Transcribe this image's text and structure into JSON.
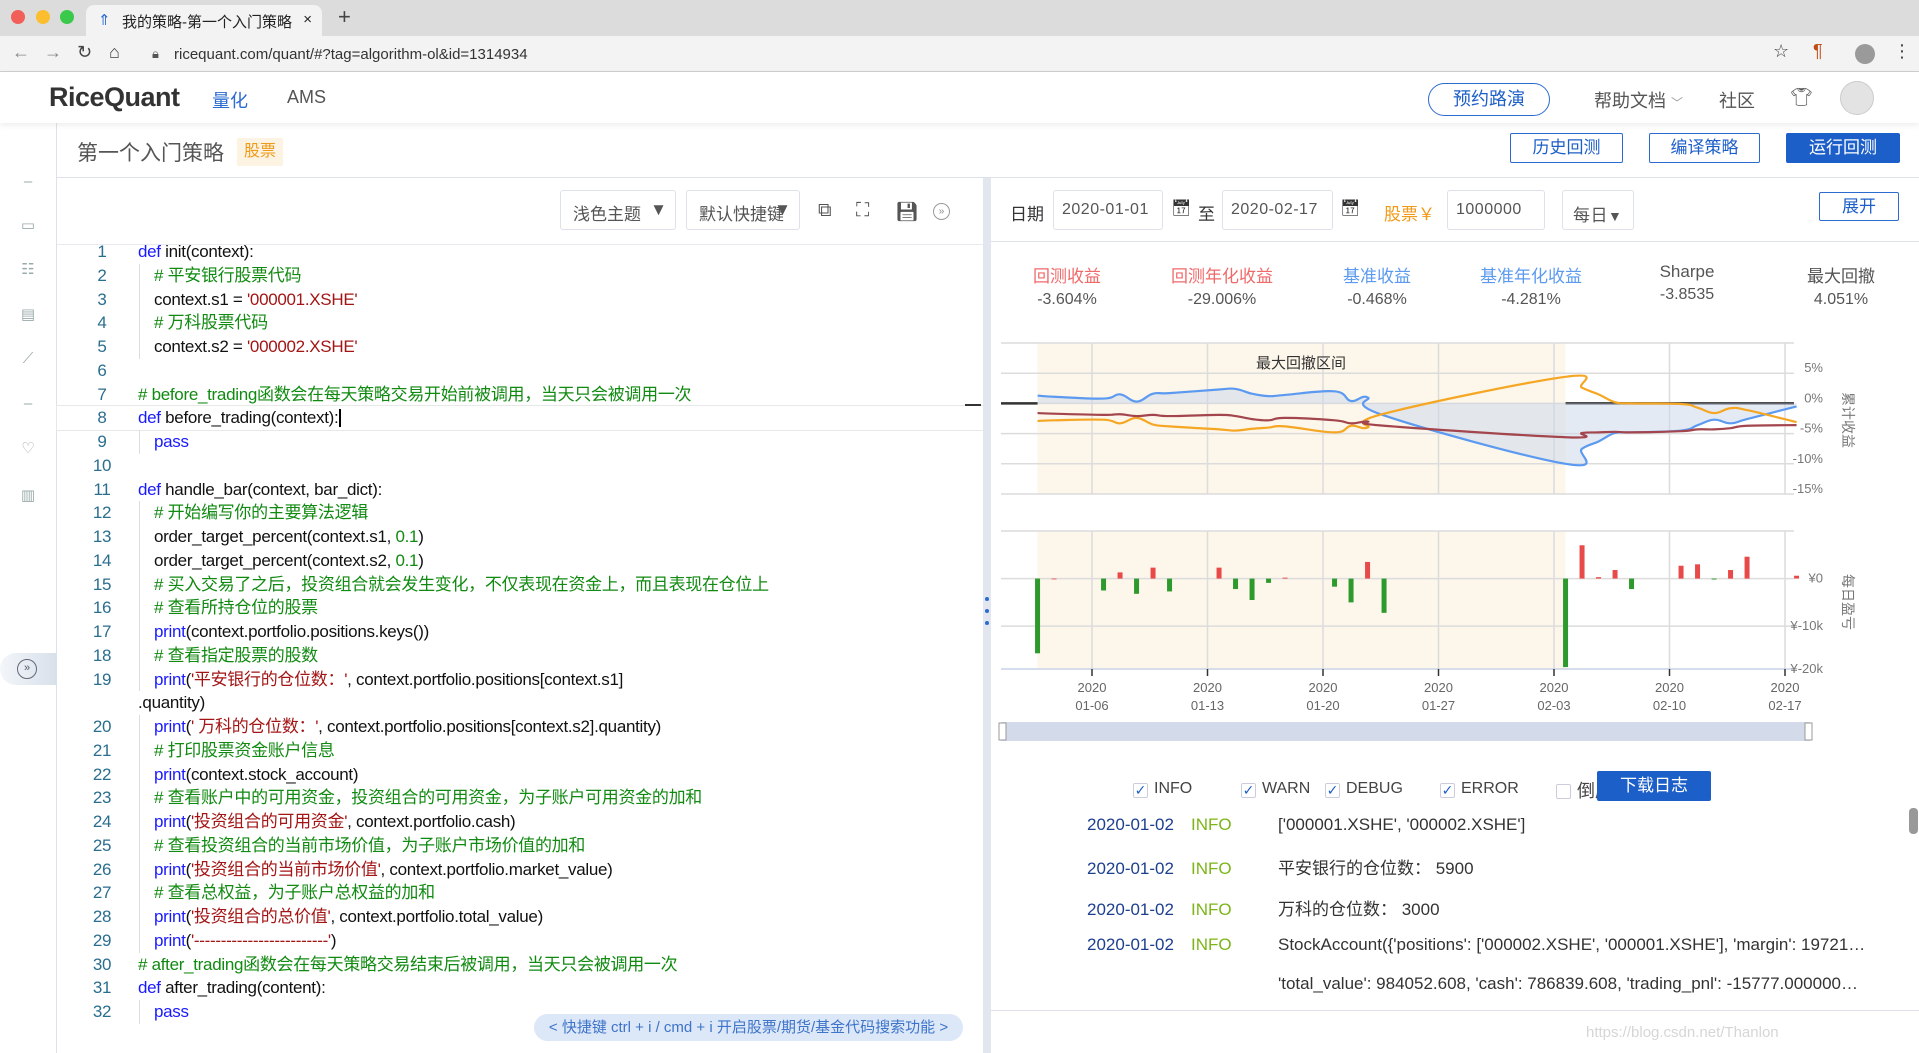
{
  "browser": {
    "tab_title": "我的策略-第一个入门策略",
    "tab_close": "×",
    "new_tab": "+",
    "url": "ricequant.com/quant/#?tag=algorithm-ol&id=1314934"
  },
  "nav": {
    "logo": "RiceQuant",
    "items": [
      {
        "label": "量化",
        "active": true
      },
      {
        "label": "AMS",
        "active": false
      }
    ],
    "roadshow": "预约路演",
    "help": "帮助文档",
    "community": "社区"
  },
  "strategy": {
    "title": "第一个入门策略",
    "badge": "股票",
    "history_button": "历史回测",
    "compile_button": "编译策略",
    "run_button": "运行回测"
  },
  "editor": {
    "theme": "浅色主题",
    "keymap": "默认快捷键",
    "hint": "< 快捷键 ctrl + i / cmd + i 开启股票/期货/基金代码搜索功能 >",
    "current_line": 8,
    "lines": [
      {
        "n": "1",
        "indent": 0,
        "tokens": [
          [
            "kw",
            "def"
          ],
          [
            "plain",
            " init(context):"
          ]
        ]
      },
      {
        "n": "2",
        "indent": 1,
        "tokens": [
          [
            "comment",
            "# 平安银行股票代码"
          ]
        ]
      },
      {
        "n": "3",
        "indent": 1,
        "tokens": [
          [
            "plain",
            "context.s1 = "
          ],
          [
            "str",
            "'000001.XSHE'"
          ]
        ]
      },
      {
        "n": "4",
        "indent": 1,
        "tokens": [
          [
            "comment",
            "# 万科股票代码"
          ]
        ]
      },
      {
        "n": "5",
        "indent": 1,
        "tokens": [
          [
            "plain",
            "context.s2 = "
          ],
          [
            "str",
            "'000002.XSHE'"
          ]
        ]
      },
      {
        "n": "6",
        "indent": 0,
        "tokens": []
      },
      {
        "n": "7",
        "indent": 0,
        "tokens": [
          [
            "comment",
            "# before_trading函数会在每天策略交易开始前被调用，当天只会被调用一次"
          ]
        ]
      },
      {
        "n": "8",
        "indent": 0,
        "tokens": [
          [
            "kw",
            "def"
          ],
          [
            "plain",
            " before_trading(context):"
          ]
        ]
      },
      {
        "n": "9",
        "indent": 1,
        "tokens": [
          [
            "kw",
            "pass"
          ]
        ]
      },
      {
        "n": "10",
        "indent": 0,
        "tokens": []
      },
      {
        "n": "11",
        "indent": 0,
        "tokens": [
          [
            "kw",
            "def"
          ],
          [
            "plain",
            " handle_bar(context, bar_dict):"
          ]
        ]
      },
      {
        "n": "12",
        "indent": 1,
        "tokens": [
          [
            "comment",
            "# 开始编写你的主要算法逻辑"
          ]
        ]
      },
      {
        "n": "13",
        "indent": 1,
        "tokens": [
          [
            "plain",
            "order_target_percent(context.s1, "
          ],
          [
            "num",
            "0.1"
          ],
          [
            "plain",
            ")"
          ]
        ]
      },
      {
        "n": "14",
        "indent": 1,
        "tokens": [
          [
            "plain",
            "order_target_percent(context.s2, "
          ],
          [
            "num",
            "0.1"
          ],
          [
            "plain",
            ")"
          ]
        ]
      },
      {
        "n": "15",
        "indent": 1,
        "tokens": [
          [
            "comment",
            "# 买入交易了之后，投资组合就会发生变化，不仅表现在资金上，而且表现在仓位上"
          ]
        ]
      },
      {
        "n": "16",
        "indent": 1,
        "tokens": [
          [
            "comment",
            "# 查看所持仓位的股票"
          ]
        ]
      },
      {
        "n": "17",
        "indent": 1,
        "tokens": [
          [
            "kw",
            "print"
          ],
          [
            "plain",
            "(context.portfolio.positions.keys())"
          ]
        ]
      },
      {
        "n": "18",
        "indent": 1,
        "tokens": [
          [
            "comment",
            "# 查看指定股票的股数"
          ]
        ]
      },
      {
        "n": "19",
        "indent": 1,
        "tokens": [
          [
            "kw",
            "print"
          ],
          [
            "plain",
            "("
          ],
          [
            "str",
            "'平安银行的仓位数：'"
          ],
          [
            "plain",
            ", context.portfolio.positions[context.s1]"
          ]
        ]
      },
      {
        "n": "",
        "indent": 0,
        "tokens": [
          [
            "plain",
            ".quantity)"
          ]
        ]
      },
      {
        "n": "20",
        "indent": 1,
        "tokens": [
          [
            "kw",
            "print"
          ],
          [
            "plain",
            "("
          ],
          [
            "str",
            "' 万科的仓位数：'"
          ],
          [
            "plain",
            ", context.portfolio.positions[context.s2].quantity)"
          ]
        ]
      },
      {
        "n": "21",
        "indent": 1,
        "tokens": [
          [
            "comment",
            "# 打印股票资金账户信息"
          ]
        ]
      },
      {
        "n": "22",
        "indent": 1,
        "tokens": [
          [
            "kw",
            "print"
          ],
          [
            "plain",
            "(context.stock_account)"
          ]
        ]
      },
      {
        "n": "23",
        "indent": 1,
        "tokens": [
          [
            "comment",
            "# 查看账户中的可用资金，投资组合的可用资金，为子账户可用资金的加和"
          ]
        ]
      },
      {
        "n": "24",
        "indent": 1,
        "tokens": [
          [
            "kw",
            "print"
          ],
          [
            "plain",
            "("
          ],
          [
            "str",
            "'投资组合的可用资金'"
          ],
          [
            "plain",
            ", context.portfolio.cash)"
          ]
        ]
      },
      {
        "n": "25",
        "indent": 1,
        "tokens": [
          [
            "comment",
            "# 查看投资组合的当前市场价值，为子账户市场价值的加和"
          ]
        ]
      },
      {
        "n": "26",
        "indent": 1,
        "tokens": [
          [
            "kw",
            "print"
          ],
          [
            "plain",
            "("
          ],
          [
            "str",
            "'投资组合的当前市场价值'"
          ],
          [
            "plain",
            ", context.portfolio.market_value)"
          ]
        ]
      },
      {
        "n": "27",
        "indent": 1,
        "tokens": [
          [
            "comment",
            "# 查看总权益，为子账户总权益的加和"
          ]
        ]
      },
      {
        "n": "28",
        "indent": 1,
        "tokens": [
          [
            "kw",
            "print"
          ],
          [
            "plain",
            "("
          ],
          [
            "str",
            "'投资组合的总价值'"
          ],
          [
            "plain",
            ", context.portfolio.total_value)"
          ]
        ]
      },
      {
        "n": "29",
        "indent": 1,
        "tokens": [
          [
            "kw",
            "print"
          ],
          [
            "plain",
            "("
          ],
          [
            "str",
            "'-------------------------'"
          ],
          [
            "plain",
            ")"
          ]
        ]
      },
      {
        "n": "30",
        "indent": 0,
        "tokens": [
          [
            "comment",
            "# after_trading函数会在每天策略交易结束后被调用，当天只会被调用一次"
          ]
        ]
      },
      {
        "n": "31",
        "indent": 0,
        "tokens": [
          [
            "kw",
            "def"
          ],
          [
            "plain",
            " after_trading(content):"
          ]
        ]
      },
      {
        "n": "32",
        "indent": 1,
        "tokens": [
          [
            "kw",
            "pass"
          ]
        ]
      }
    ]
  },
  "backtest": {
    "date_label": "日期",
    "start_date": "2020-01-01",
    "to_label": "至",
    "end_date": "2020-02-17",
    "asset_label": "股票￥",
    "capital": "1000000",
    "frequency": "每日",
    "expand_button": "展开"
  },
  "stats": [
    {
      "label": "回测收益",
      "value": "-3.604%",
      "color": "#f06a6a"
    },
    {
      "label": "回测年化收益",
      "value": "-29.006%",
      "color": "#f06a6a"
    },
    {
      "label": "基准收益",
      "value": "-0.468%",
      "color": "#5b9af0"
    },
    {
      "label": "基准年化收益",
      "value": "-4.281%",
      "color": "#5b9af0"
    },
    {
      "label": "Sharpe",
      "value": "-3.8535",
      "color": "#555555"
    },
    {
      "label": "最大回撤",
      "value": "4.051%",
      "color": "#555555"
    }
  ],
  "chart_data": [
    {
      "type": "line",
      "ylabel": "累计收益",
      "ylim": [
        -15,
        10
      ],
      "yticks": [
        5,
        0,
        -5,
        -10,
        -15
      ],
      "ytick_labels": [
        "5%",
        "0%",
        "-5%",
        "-10%",
        "-15%"
      ],
      "grid": true,
      "drawdown_label": "最大回撤区间",
      "drawdown_period": [
        "2020-01-02",
        "2020-02-03"
      ],
      "xticks": [
        "2020-01-06",
        "2020-01-13",
        "2020-01-20",
        "2020-01-27",
        "2020-02-03",
        "2020-02-10",
        "2020-02-17"
      ],
      "x": [
        "2020-01-02",
        "2020-01-03",
        "2020-01-06",
        "2020-01-07",
        "2020-01-08",
        "2020-01-09",
        "2020-01-10",
        "2020-01-13",
        "2020-01-14",
        "2020-01-15",
        "2020-01-16",
        "2020-01-17",
        "2020-01-20",
        "2020-01-21",
        "2020-01-22",
        "2020-01-23",
        "2020-02-03",
        "2020-02-04",
        "2020-02-05",
        "2020-02-06",
        "2020-02-07",
        "2020-02-10",
        "2020-02-11",
        "2020-02-12",
        "2020-02-13",
        "2020-02-14",
        "2020-02-17"
      ],
      "series": [
        {
          "color": "#5b9af0",
          "filled": true,
          "values": [
            1.3,
            1.1,
            0.8,
            1.5,
            0.3,
            1.6,
            1.7,
            2.3,
            2.4,
            1.6,
            1.2,
            1.4,
            2.0,
            0.4,
            1.0,
            -2.0,
            -10.0,
            -7.5,
            -6.3,
            -4.9,
            -4.8,
            -4.5,
            -3.6,
            -2.7,
            -3.3,
            -2.6,
            -0.5
          ]
        },
        {
          "color": "#f5a623",
          "values": [
            -2.9,
            -2.8,
            -2.7,
            -3.3,
            -2.4,
            -3.5,
            -3.8,
            -4.3,
            -4.5,
            -4.2,
            -4.0,
            -3.8,
            -4.8,
            -3.7,
            -4.0,
            -1.7,
            4.4,
            2.6,
            1.5,
            0.2,
            0.0,
            -0.1,
            -0.7,
            -1.6,
            -0.8,
            -1.1,
            -3.1
          ]
        },
        {
          "color": "#a3454c",
          "values": [
            -1.6,
            -1.7,
            -1.9,
            -1.8,
            -2.1,
            -1.9,
            -2.1,
            -1.9,
            -2.1,
            -2.6,
            -2.8,
            -2.4,
            -2.8,
            -3.3,
            -3.0,
            -3.7,
            -5.6,
            -4.9,
            -4.8,
            -4.7,
            -4.8,
            -4.6,
            -4.3,
            -4.3,
            -4.1,
            -3.7,
            -3.6
          ]
        }
      ]
    },
    {
      "type": "bar",
      "ylabel": "每日盈亏",
      "ylim": [
        -19000,
        10000
      ],
      "yticks": [
        0,
        -10000,
        -20000
      ],
      "ytick_labels": [
        "¥0",
        "¥-10k",
        "¥-20k"
      ],
      "grid": true,
      "positive_color": "#e84a4a",
      "negative_color": "#2e9a2e",
      "x": [
        "2020-01-02",
        "2020-01-03",
        "2020-01-06",
        "2020-01-07",
        "2020-01-08",
        "2020-01-09",
        "2020-01-10",
        "2020-01-13",
        "2020-01-14",
        "2020-01-15",
        "2020-01-16",
        "2020-01-17",
        "2020-01-20",
        "2020-01-21",
        "2020-01-22",
        "2020-01-23",
        "2020-02-03",
        "2020-02-04",
        "2020-02-05",
        "2020-02-06",
        "2020-02-07",
        "2020-02-10",
        "2020-02-11",
        "2020-02-12",
        "2020-02-13",
        "2020-02-14",
        "2020-02-17"
      ],
      "xticks": [
        "2020-01-06",
        "2020-01-13",
        "2020-01-20",
        "2020-01-27",
        "2020-02-03",
        "2020-02-10",
        "2020-02-17"
      ],
      "xtick_years": [
        "2020",
        "2020",
        "2020",
        "2020",
        "2020",
        "2020",
        "2020"
      ],
      "xtick_days": [
        "01-06",
        "01-13",
        "01-20",
        "01-27",
        "02-03",
        "02-10",
        "02-17"
      ],
      "values": [
        -15700,
        0,
        -2500,
        1300,
        -3200,
        2300,
        -2700,
        2300,
        -2200,
        -4500,
        -900,
        200,
        -1700,
        -5000,
        3500,
        -7200,
        -18600,
        7000,
        300,
        1800,
        -2200,
        2700,
        3000,
        -200,
        1800,
        4600,
        600
      ]
    }
  ],
  "logs": {
    "filters": [
      {
        "label": "INFO",
        "checked": true
      },
      {
        "label": "WARN",
        "checked": true
      },
      {
        "label": "DEBUG",
        "checked": true
      },
      {
        "label": "ERROR",
        "checked": true
      }
    ],
    "reverse": {
      "label": "倒序",
      "checked": false
    },
    "download_button": "下载日志",
    "check_mark": "✓",
    "rows": [
      {
        "date": "2020-01-02",
        "level": "INFO",
        "message": "['000001.XSHE', '000002.XSHE']"
      },
      {
        "date": "2020-01-02",
        "level": "INFO",
        "message": "平安银行的仓位数： 5900"
      },
      {
        "date": "2020-01-02",
        "level": "INFO",
        "message": "万科的仓位数： 3000"
      },
      {
        "date": "2020-01-02",
        "level": "INFO",
        "message": "StockAccount({'positions': ['000002.XSHE', '000001.XSHE'], 'margin': 19721…"
      },
      {
        "date": "",
        "level": "",
        "message": "'total_value': 984052.608, 'cash': 786839.608, 'trading_pnl': -15777.000000…"
      }
    ]
  },
  "watermark": "https://blog.csdn.net/Thanlon"
}
